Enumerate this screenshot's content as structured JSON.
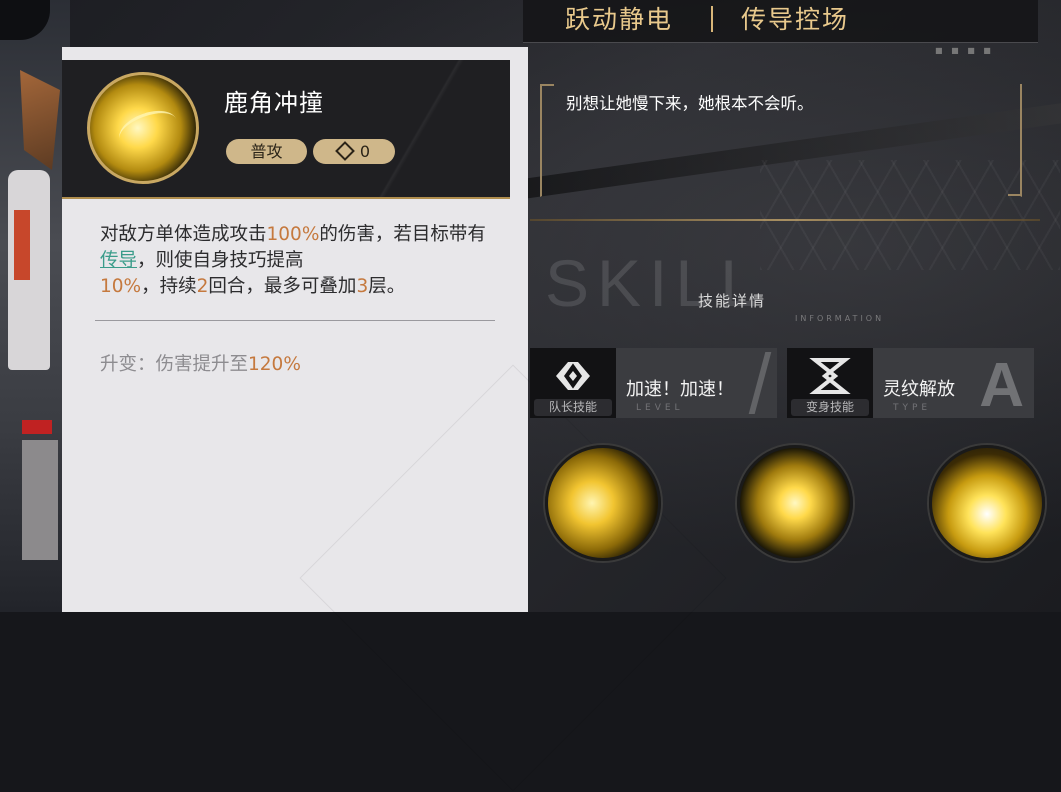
{
  "header": {
    "title_left": "跃动静电",
    "title_right": "传导控场"
  },
  "quote": "别想让她慢下来，她根本不会听。",
  "skill_detail": {
    "name": "鹿角冲撞",
    "type_tag": "普攻",
    "cost": "0",
    "description": {
      "p1": "对敌方单体造成攻击",
      "v1": "100%",
      "p2": "的伤害，若目标带有",
      "link": "传导",
      "p3": "，则使自身技巧提高",
      "v2": "10%",
      "p4": "，持续",
      "v3": "2",
      "p5": "回合，最多可叠加",
      "v4": "3",
      "p6": "层。"
    },
    "upgrade": {
      "prefix": "升变：伤害提升至",
      "value": "120%"
    }
  },
  "skill_section": {
    "watermark": "SKILL",
    "title_cn": "技能详情",
    "title_en": "INFORMATION"
  },
  "cards": {
    "captain": {
      "label": "队长技能",
      "name": "加速！加速！",
      "faint": "LEVEL",
      "icon": "captain-skill-icon"
    },
    "transform": {
      "label": "变身技能",
      "name": "灵纹解放",
      "faint": "TYPE",
      "grade": "A",
      "icon": "transform-skill-icon"
    }
  },
  "skills": [
    {
      "icon": "antler-charge-icon"
    },
    {
      "icon": "electric-orb-icon"
    },
    {
      "icon": "lightning-strike-icon"
    }
  ],
  "colors": {
    "accent_gold": "#e9c98c",
    "value_orange": "#c5793e",
    "link_teal": "#3a9c8a"
  }
}
